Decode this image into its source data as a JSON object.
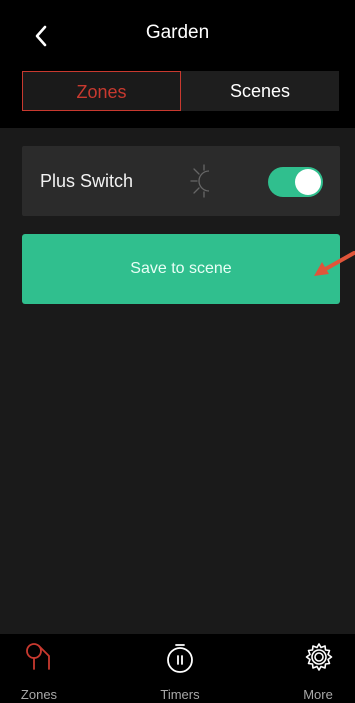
{
  "header": {
    "title": "Garden"
  },
  "segments": {
    "zones_label": "Zones",
    "scenes_label": "Scenes",
    "active": "Zones"
  },
  "zone_card": {
    "name": "Plus Switch",
    "icon": "night-mode-icon",
    "switch_on": true
  },
  "save_button": {
    "label": "Save to scene"
  },
  "tabbar": {
    "items": [
      {
        "label": "Zones",
        "icon": "zones-icon",
        "active": true
      },
      {
        "label": "Timers",
        "icon": "timer-icon",
        "active": false
      },
      {
        "label": "More",
        "icon": "gear-icon",
        "active": false
      }
    ]
  },
  "colors": {
    "accent_red": "#c8392f",
    "accent_green": "#30bf8e",
    "annotation_arrow": "#e0553a"
  }
}
